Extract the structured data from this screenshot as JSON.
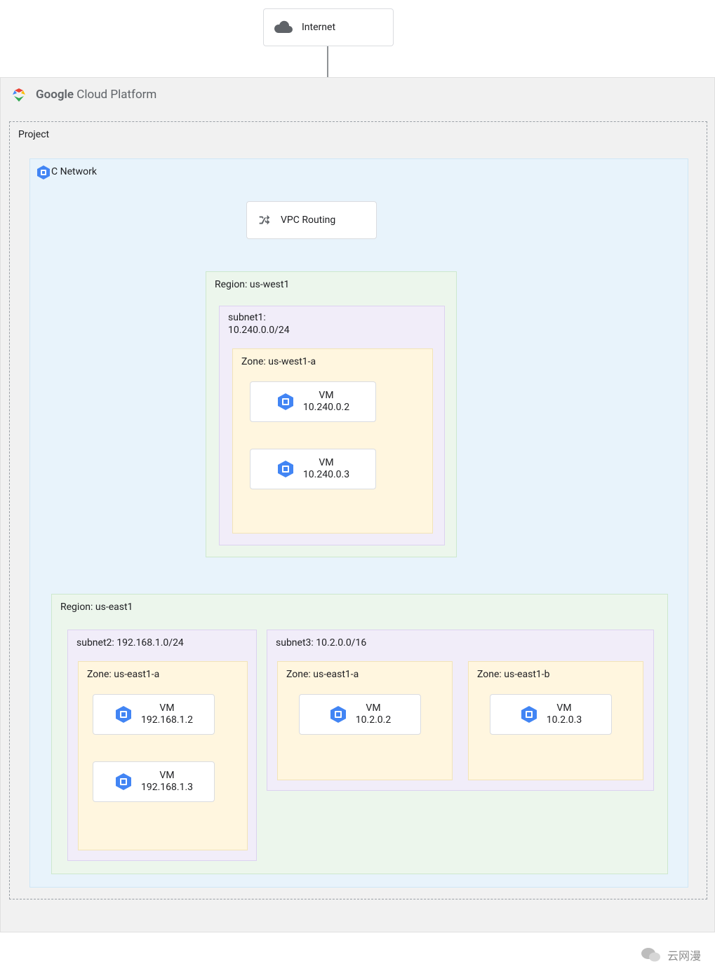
{
  "internet": {
    "label": "Internet"
  },
  "gcp": {
    "title_bold": "Google",
    "title_rest": " Cloud Platform"
  },
  "project": {
    "label": "Project"
  },
  "vpc": {
    "label": "C Network",
    "routing": {
      "label": "VPC Routing"
    }
  },
  "regions": {
    "west": {
      "label": "Region: us-west1",
      "subnet": {
        "label": "subnet1:",
        "cidr": "10.240.0.0/24",
        "zone": {
          "label": "Zone: us-west1-a",
          "vms": [
            {
              "name": "VM",
              "ip": "10.240.0.2"
            },
            {
              "name": "VM",
              "ip": "10.240.0.3"
            }
          ]
        }
      }
    },
    "east": {
      "label": "Region: us-east1",
      "subnet2": {
        "label": "subnet2: 192.168.1.0/24",
        "zone": {
          "label": "Zone: us-east1-a",
          "vms": [
            {
              "name": "VM",
              "ip": "192.168.1.2"
            },
            {
              "name": "VM",
              "ip": "192.168.1.3"
            }
          ]
        }
      },
      "subnet3": {
        "label": "subnet3: 10.2.0.0/16",
        "zoneA": {
          "label": "Zone: us-east1-a",
          "vm": {
            "name": "VM",
            "ip": "10.2.0.2"
          }
        },
        "zoneB": {
          "label": "Zone: us-east1-b",
          "vm": {
            "name": "VM",
            "ip": "10.2.0.3"
          }
        }
      }
    }
  },
  "watermark": {
    "text": "云网漫"
  }
}
